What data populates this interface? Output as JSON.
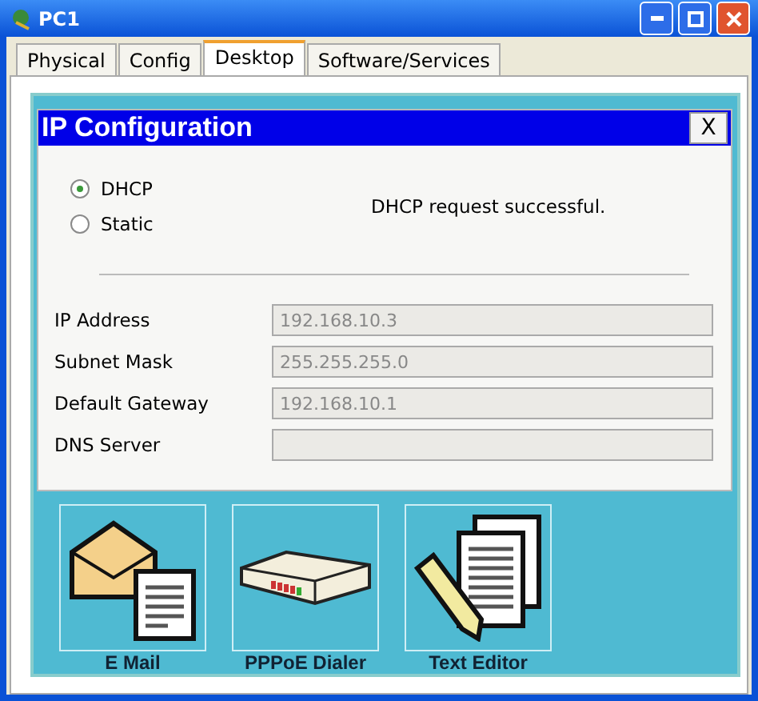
{
  "window": {
    "title": "PC1"
  },
  "tabs": [
    {
      "label": "Physical",
      "selected": false
    },
    {
      "label": "Config",
      "selected": false
    },
    {
      "label": "Desktop",
      "selected": true
    },
    {
      "label": "Software/Services",
      "selected": false
    }
  ],
  "dialog": {
    "title": "IP Configuration",
    "close": "X",
    "modes": [
      {
        "label": "DHCP",
        "selected": true
      },
      {
        "label": "Static",
        "selected": false
      }
    ],
    "status": "DHCP request successful.",
    "fields": [
      {
        "label": "IP Address",
        "value": "192.168.10.3"
      },
      {
        "label": "Subnet Mask",
        "value": "255.255.255.0"
      },
      {
        "label": "Default Gateway",
        "value": "192.168.10.1"
      },
      {
        "label": "DNS Server"
      }
    ]
  },
  "apps": [
    {
      "kind": "mail",
      "label": "E Mail"
    },
    {
      "kind": "dialer",
      "label": "PPPoE Dialer"
    },
    {
      "kind": "editor",
      "label": "Text Editor"
    }
  ]
}
